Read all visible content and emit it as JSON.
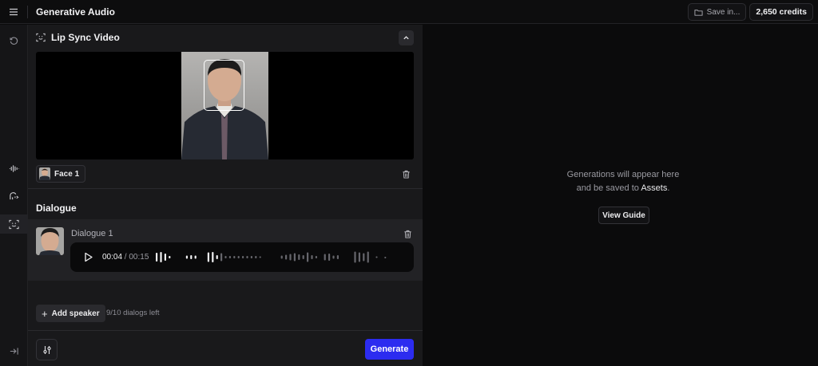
{
  "header": {
    "title": "Generative Audio",
    "save_label": "Save in...",
    "credits_label": "2,650 credits"
  },
  "rail": {
    "items": [
      {
        "icon": "history-icon"
      },
      {
        "icon": "waveform-icon"
      },
      {
        "icon": "voice-icon"
      },
      {
        "icon": "face-scan-icon",
        "active": true
      },
      {
        "icon": "expand-panel-icon"
      }
    ]
  },
  "lip_sync": {
    "title": "Lip Sync Video",
    "face_chip_label": "Face 1"
  },
  "dialogue": {
    "title": "Dialogue",
    "items": [
      {
        "name": "Dialogue 1",
        "current_time": "00:04",
        "separator": " / ",
        "duration": "00:15",
        "progress_fraction": 0.27
      }
    ],
    "add_speaker_label": "Add speaker",
    "dialogs_left": "9/10 dialogs left",
    "generate_label": "Generate"
  },
  "output": {
    "empty_line1": "Generations will appear here",
    "empty_line2_prefix": "and be saved to ",
    "empty_line2_link": "Assets",
    "empty_line2_suffix": ".",
    "guide_label": "View Guide"
  },
  "colors": {
    "accent": "#2c2cf0",
    "background": "#0b0b0c",
    "panel": "#19191b"
  }
}
